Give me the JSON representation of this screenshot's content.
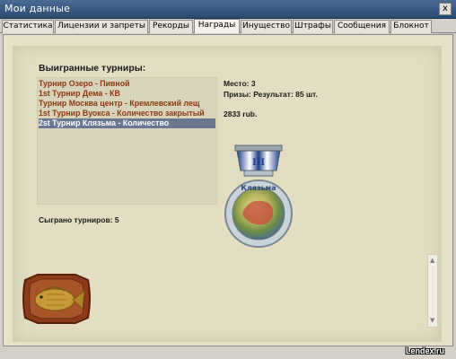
{
  "window": {
    "title": "Мои данные",
    "close_label": "x"
  },
  "tabs": [
    {
      "label": "Статистика"
    },
    {
      "label": "Лицензии и запреты"
    },
    {
      "label": "Рекорды"
    },
    {
      "label": "Награды"
    },
    {
      "label": "Инущество"
    },
    {
      "label": "Штрафы"
    },
    {
      "label": "Сообщения"
    },
    {
      "label": "Блокнот"
    }
  ],
  "active_tab": "Награды",
  "tournaments": {
    "heading": "Выигранные турниры:",
    "items": [
      {
        "label": "Турнир Озеро - Пивной"
      },
      {
        "label": "1st Турнир Дема - КВ"
      },
      {
        "label": "Турнир Москва центр - Кремлевский лещ"
      },
      {
        "label": "1st Турнир Вуокса - Количество закрытый"
      },
      {
        "label": "2st Турнир Клязьма - Количество"
      }
    ],
    "selected_index": 4,
    "played_label": "Сыграно турниров: 5"
  },
  "details": {
    "place": "Место: 3",
    "prize": "Призы: Результат: 85 шт.",
    "money": "2833 rub."
  },
  "medal": {
    "ribbon_text": "III",
    "name": "Клязьма",
    "colors": {
      "ribbon": "#1f3f8a",
      "rim": "#b7c3c9",
      "center": "#8ea84a"
    }
  },
  "watermark": "Lendex.ru",
  "colors": {
    "title_bar": "#2b4a72",
    "list_text": "#8b3a0e",
    "selected_bg": "#6a7790",
    "content_bg": "#e3dec3"
  }
}
